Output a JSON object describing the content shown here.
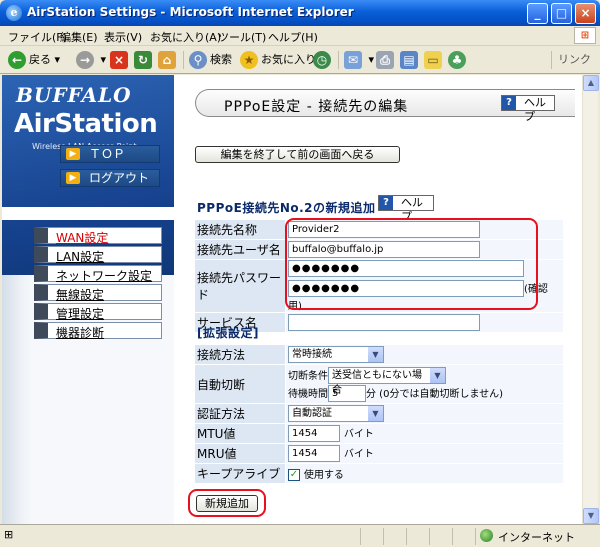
{
  "window": {
    "title": "AirStation Settings - Microsoft Internet Explorer",
    "minimize": "_",
    "maximize": "□",
    "close": "×"
  },
  "menubar": [
    "ファイル(F)",
    "編集(E)",
    "表示(V)",
    "お気に入り(A)",
    "ツール(T)",
    "ヘルプ(H)"
  ],
  "toolbar": {
    "back": "戻る",
    "search": "検索",
    "favorites": "お気に入り",
    "links": "リンク"
  },
  "sidebar": {
    "brand": "BUFFALO",
    "product": "AirStation",
    "subtitle": "Wireless LAN Access Point",
    "top_button": "ＴＯＰ",
    "logout_button": "ログアウト",
    "items": [
      {
        "label": "WAN設定",
        "active": true
      },
      {
        "label": "LAN設定",
        "active": false
      },
      {
        "label": "ネットワーク設定",
        "active": false
      },
      {
        "label": "無線設定",
        "active": false
      },
      {
        "label": "管理設定",
        "active": false
      },
      {
        "label": "機器診断",
        "active": false
      }
    ]
  },
  "main": {
    "page_title": "PPPoE設定 - 接続先の編集",
    "help_label": "ヘルプ",
    "back_button": "編集を終了して前の画面へ戻る",
    "section_title": "PPPoE接続先No.2の新規追加",
    "section_help_label": "ヘルプ",
    "fields": {
      "name_label": "接続先名称",
      "name_value": "Provider2",
      "user_label": "接続先ユーザ名",
      "user_value": "buffalo@buffalo.jp",
      "password_label": "接続先パスワード",
      "password_value": "●●●●●●●",
      "password_confirm_value": "●●●●●●●",
      "password_confirm_note": "(確認用)",
      "service_label": "サービス名",
      "service_value": ""
    },
    "advanced_title": "[拡張設定]",
    "advanced": {
      "method_label": "接続方法",
      "method_value": "常時接続",
      "autodisconnect_label": "自動切断",
      "condition_label": "切断条件",
      "condition_value": "送受信ともにない場合",
      "wait_label": "待機時間",
      "wait_value": "5",
      "wait_suffix": "分 (0分では自動切断しません)",
      "auth_label": "認証方法",
      "auth_value": "自動認証",
      "mtu_label": "MTU値",
      "mtu_value": "1454",
      "mtu_unit": "バイト",
      "mru_label": "MRU値",
      "mru_value": "1454",
      "mru_unit": "バイト",
      "keepalive_label": "キープアライブ",
      "keepalive_checkbox": "使用する",
      "keepalive_checked": true
    },
    "add_button": "新規追加"
  },
  "statusbar": {
    "zone": "インターネット"
  },
  "colors": {
    "highlight_frame": "#e8101c",
    "active_menu_text": "#d60000",
    "sidebar_brand_bg": "#15408c",
    "nav_arrow": "#f2b012"
  }
}
